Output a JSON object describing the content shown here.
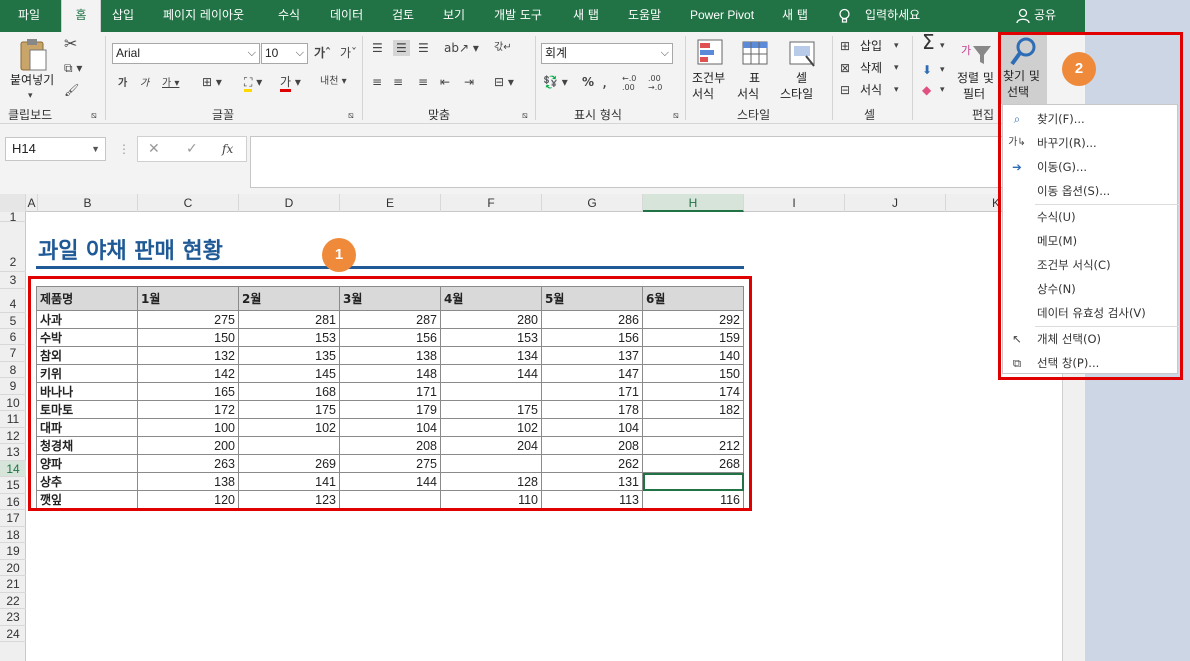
{
  "tabs": [
    "파일",
    "홈",
    "삽입",
    "페이지 레이아웃",
    "수식",
    "데이터",
    "검토",
    "보기",
    "개발 도구",
    "새 탭",
    "도움말",
    "Power Pivot",
    "새 탭",
    "입력하세요"
  ],
  "share_label": "공유",
  "ribbon": {
    "clipboard": {
      "paste": "붙여넣기",
      "label": "클립보드"
    },
    "font": {
      "name": "Arial",
      "size": "10",
      "label": "글꼴"
    },
    "align": {
      "label": "맞춤"
    },
    "number": {
      "format": "회계",
      "label": "표시 형식"
    },
    "styles": {
      "cond": "조건부\n서식",
      "cond1": "조건부",
      "cond2": "서식",
      "table1": "표",
      "table2": "서식",
      "cell1": "셀",
      "cell2": "스타일",
      "label": "스타일"
    },
    "cells": {
      "insert": "삽입",
      "delete": "삭제",
      "format": "서식",
      "label": "셀"
    },
    "editing": {
      "sort1": "정렬 및",
      "sort2": "필터",
      "find1": "찾기 및",
      "find2": "선택",
      "label": "편집"
    }
  },
  "namebox": "H14",
  "fx": "fx",
  "columns": [
    "A",
    "B",
    "C",
    "D",
    "E",
    "F",
    "G",
    "H",
    "I",
    "J",
    "K"
  ],
  "rows": [
    "1",
    "2",
    "3",
    "4",
    "5",
    "6",
    "7",
    "8",
    "9",
    "10",
    "11",
    "12",
    "13",
    "14",
    "15",
    "16",
    "17",
    "18",
    "19",
    "20",
    "21",
    "22",
    "23",
    "24"
  ],
  "sheet": {
    "title": "과일 야채 판매 현황",
    "headers": [
      "제품명",
      "1월",
      "2월",
      "3월",
      "4월",
      "5월",
      "6월"
    ],
    "data": [
      [
        "사과",
        "275",
        "281",
        "287",
        "280",
        "286",
        "292"
      ],
      [
        "수박",
        "150",
        "153",
        "156",
        "153",
        "156",
        "159"
      ],
      [
        "참외",
        "132",
        "135",
        "138",
        "134",
        "137",
        "140"
      ],
      [
        "키위",
        "142",
        "145",
        "148",
        "144",
        "147",
        "150"
      ],
      [
        "바나나",
        "165",
        "168",
        "171",
        "",
        "171",
        "174"
      ],
      [
        "토마토",
        "172",
        "175",
        "179",
        "175",
        "178",
        "182"
      ],
      [
        "대파",
        "100",
        "102",
        "104",
        "102",
        "104",
        ""
      ],
      [
        "청경채",
        "200",
        "",
        "208",
        "204",
        "208",
        "212"
      ],
      [
        "양파",
        "263",
        "269",
        "275",
        "",
        "262",
        "268"
      ],
      [
        "상추",
        "138",
        "141",
        "144",
        "128",
        "131",
        ""
      ],
      [
        "깻잎",
        "120",
        "123",
        "",
        "110",
        "113",
        "116"
      ]
    ]
  },
  "badges": {
    "one": "1",
    "two": "2"
  },
  "find_menu": [
    {
      "label": "찾기(F)...",
      "icon": "magnifier-icon"
    },
    {
      "label": "바꾸기(R)...",
      "icon": "replace-icon"
    },
    {
      "label": "이동(G)...",
      "icon": "arrow-right-icon"
    },
    {
      "label": "이동 옵션(S)...",
      "icon": ""
    },
    {
      "label": "수식(U)",
      "icon": ""
    },
    {
      "label": "메모(M)",
      "icon": ""
    },
    {
      "label": "조건부 서식(C)",
      "icon": ""
    },
    {
      "label": "상수(N)",
      "icon": ""
    },
    {
      "label": "데이터 유효성 검사(V)",
      "icon": ""
    },
    {
      "label": "개체 선택(O)",
      "icon": "cursor-icon"
    },
    {
      "label": "선택 창(P)...",
      "icon": "selection-pane-icon"
    }
  ],
  "colors": {
    "accent": "#217346",
    "title": "#1f5a96",
    "highlight": "#e00000",
    "badge": "#ef8a3a"
  }
}
